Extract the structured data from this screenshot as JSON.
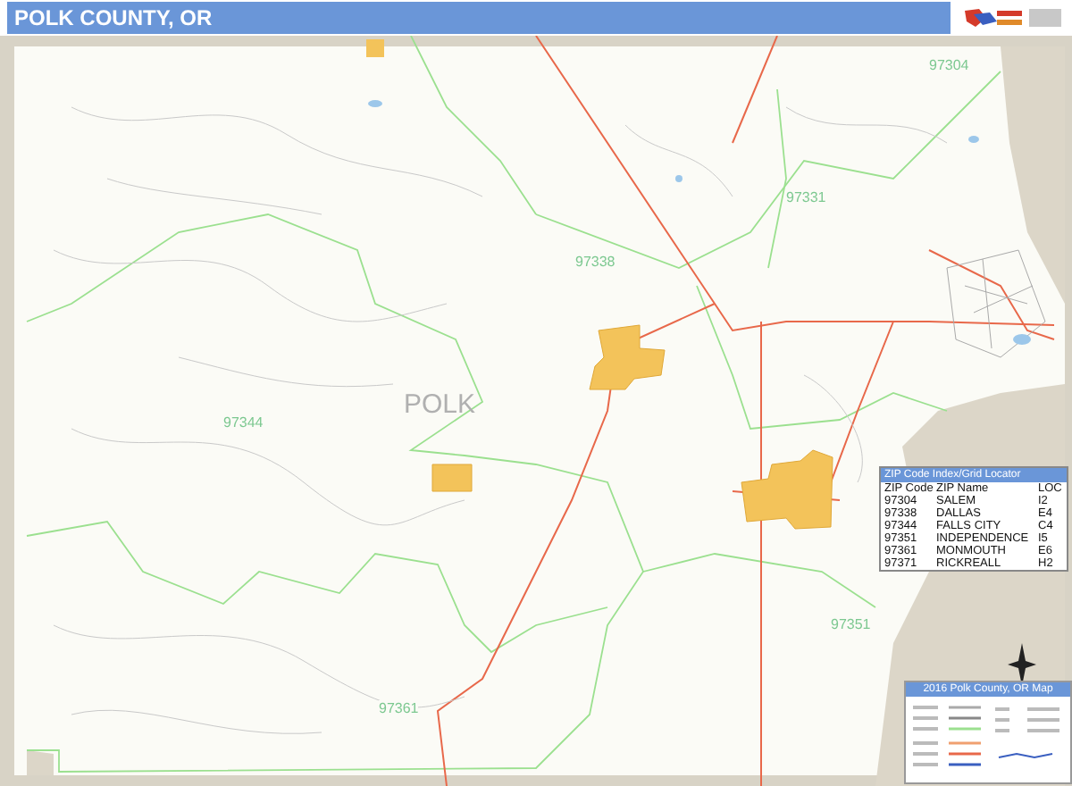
{
  "header": {
    "title": "POLK COUNTY, OR"
  },
  "map": {
    "county_label": "POLK",
    "zip_labels": [
      "97304",
      "97331",
      "97338",
      "97344",
      "97351",
      "97361"
    ]
  },
  "zip_index": {
    "title": "ZIP Code Index/Grid Locator",
    "columns": [
      "ZIP Code",
      "ZIP Name",
      "LOC"
    ],
    "rows": [
      [
        "97304",
        "SALEM",
        "I2"
      ],
      [
        "97338",
        "DALLAS",
        "E4"
      ],
      [
        "97344",
        "FALLS CITY",
        "C4"
      ],
      [
        "97351",
        "INDEPENDENCE",
        "I5"
      ],
      [
        "97361",
        "MONMOUTH",
        "E6"
      ],
      [
        "97371",
        "RICKREALL",
        "H2"
      ]
    ]
  },
  "legend": {
    "title": "2016 Polk County, OR Map"
  }
}
